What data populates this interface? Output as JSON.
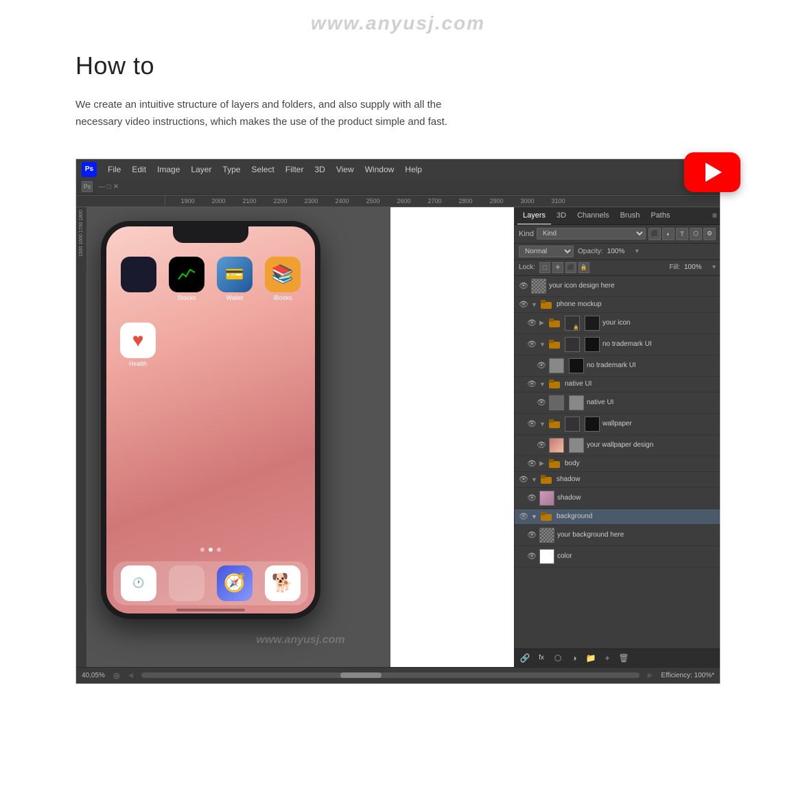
{
  "watermark_top": "www.anyusj.com",
  "header": {
    "title": "How to",
    "description": "We create an intuitive structure of layers and folders, and also supply with all the necessary video instructions, which makes the use of the product simple and fast."
  },
  "photoshop": {
    "menubar": {
      "logo": "Ps",
      "menus": [
        "File",
        "Edit",
        "Image",
        "Layer",
        "Type",
        "Select",
        "Filter",
        "3D",
        "View",
        "Window",
        "Help"
      ]
    },
    "ruler": {
      "numbers": [
        "1900",
        "2000",
        "2100",
        "2200",
        "2300",
        "2400",
        "2500",
        "2600",
        "2700",
        "2800",
        "2900",
        "3000",
        "3100"
      ]
    },
    "statusbar": {
      "zoom": "40,05%",
      "nav_icon": "◎",
      "info": "Efficiency: 100%*"
    }
  },
  "layers_panel": {
    "tabs": [
      "Layers",
      "3D",
      "Channels",
      "Brush",
      "Paths"
    ],
    "active_tab": "Layers",
    "kind_label": "Kind",
    "blend_mode": "Normal",
    "opacity_label": "Opacity:",
    "opacity_value": "100%",
    "fill_label": "Fill:",
    "fill_value": "100%",
    "lock_label": "Lock:",
    "layers": [
      {
        "name": "your icon design here",
        "indent": 0,
        "type": "layer",
        "thumb": "checker",
        "eye": true,
        "is_folder": false
      },
      {
        "name": "phone mockup",
        "indent": 0,
        "type": "folder",
        "eye": true,
        "is_folder": true,
        "expanded": true
      },
      {
        "name": "your icon",
        "indent": 1,
        "type": "folder",
        "eye": true,
        "is_folder": true,
        "expanded": false
      },
      {
        "name": "no trademark UI",
        "indent": 1,
        "type": "folder",
        "eye": true,
        "is_folder": true,
        "expanded": true
      },
      {
        "name": "no trademark UI",
        "indent": 2,
        "type": "layer",
        "thumb": "black",
        "eye": true,
        "is_folder": false
      },
      {
        "name": "native UI",
        "indent": 1,
        "type": "folder",
        "eye": true,
        "is_folder": true,
        "expanded": true
      },
      {
        "name": "native UI",
        "indent": 2,
        "type": "layer",
        "thumb": "gray_img",
        "eye": true,
        "is_folder": false
      },
      {
        "name": "wallpaper",
        "indent": 1,
        "type": "folder",
        "eye": true,
        "is_folder": true,
        "expanded": true
      },
      {
        "name": "your wallpaper design",
        "indent": 2,
        "type": "layer",
        "thumb": "gray_img2",
        "eye": true,
        "is_folder": false
      },
      {
        "name": "body",
        "indent": 1,
        "type": "folder",
        "eye": true,
        "is_folder": true,
        "expanded": false
      },
      {
        "name": "shadow",
        "indent": 0,
        "type": "folder",
        "eye": true,
        "is_folder": true,
        "expanded": true
      },
      {
        "name": "shadow",
        "indent": 1,
        "type": "layer",
        "thumb": "pink",
        "eye": true,
        "is_folder": false
      },
      {
        "name": "background",
        "indent": 0,
        "type": "folder",
        "eye": true,
        "is_folder": true,
        "expanded": true
      },
      {
        "name": "your background here",
        "indent": 1,
        "type": "layer",
        "thumb": "checker2",
        "eye": true,
        "is_folder": false
      },
      {
        "name": "color",
        "indent": 1,
        "type": "layer",
        "thumb": "white",
        "eye": true,
        "is_folder": false
      }
    ]
  },
  "youtube": {
    "label": "▶"
  },
  "canvas_watermarks": [
    "www.anyusj.com",
    "www.anyusj.com"
  ]
}
